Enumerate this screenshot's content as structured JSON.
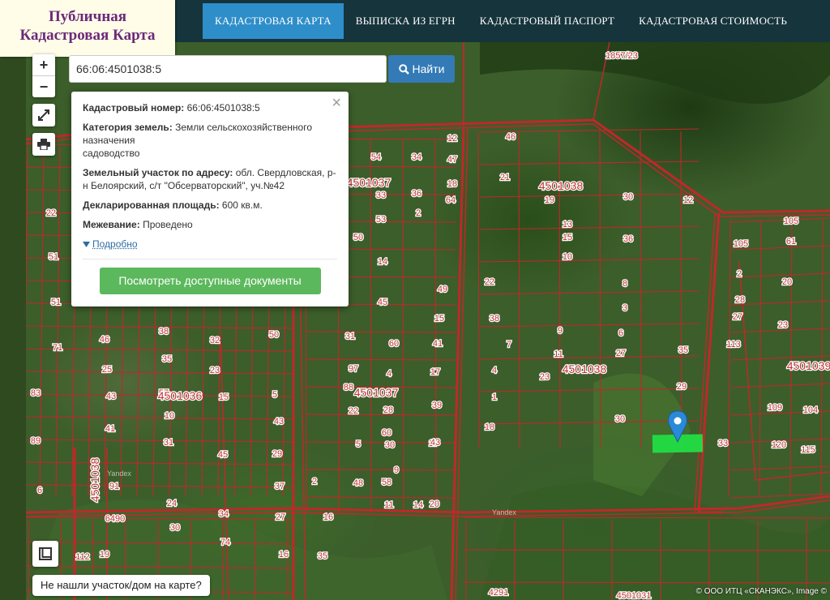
{
  "logo": {
    "line1": "Публичная",
    "line2": "Кадастровая Карта"
  },
  "nav": {
    "items": [
      {
        "label": "КАДАСТРОВАЯ КАРТА",
        "active": true
      },
      {
        "label": "ВЫПИСКА ИЗ ЕГРН",
        "active": false
      },
      {
        "label": "КАДАСТРОВЫЙ ПАСПОРТ",
        "active": false
      },
      {
        "label": "КАДАСТРОВАЯ СТОИМОСТЬ",
        "active": false
      }
    ]
  },
  "search": {
    "value": "66:06:4501038:5",
    "button_label": "Найти"
  },
  "controls": {
    "zoom_in": "+",
    "zoom_out": "−"
  },
  "popup": {
    "close": "×",
    "cadastral_number_label": "Кадастровый номер:",
    "cadastral_number": "66:06:4501038:5",
    "category_label": "Категория земель:",
    "category_value": "Земли сельскохозяйственного назначения",
    "usage": "садоводство",
    "address_label": "Земельный участок по адресу:",
    "address_value": "обл. Свердловская, р-н Белоярский, с/т \"Обсерваторский\", уч.№42",
    "area_label": "Декларированная площадь:",
    "area_value": "600 кв.м.",
    "survey_label": "Межевание:",
    "survey_value": "Проведено",
    "more_link": "Подробно",
    "docs_button": "Посмотреть доступные документы"
  },
  "map": {
    "quarter_labels": [
      "4501037",
      "4501038",
      "4501036",
      "4501037",
      "4501038",
      "4501039",
      "4501038"
    ],
    "plot_labels": [
      "1857/23",
      "54",
      "34",
      "12",
      "47",
      "46",
      "22",
      "33",
      "36",
      "18",
      "64",
      "2",
      "51",
      "53",
      "50",
      "21",
      "19",
      "30",
      "12",
      "13",
      "15",
      "36",
      "105",
      "105",
      "61",
      "51",
      "14",
      "10",
      "22",
      "49",
      "8",
      "2",
      "20",
      "45",
      "38",
      "15",
      "3",
      "71",
      "46",
      "38",
      "32",
      "50",
      "31",
      "60",
      "41",
      "9",
      "7",
      "6",
      "27",
      "35",
      "113",
      "28",
      "27",
      "23",
      "25",
      "35",
      "23",
      "97",
      "4",
      "17",
      "4",
      "11",
      "23",
      "83",
      "43",
      "57",
      "5",
      "88",
      "39",
      "1",
      "29",
      "41",
      "10",
      "15",
      "43",
      "22",
      "28",
      "17",
      "18",
      "30",
      "109",
      "104",
      "89",
      "31",
      "45",
      "29",
      "60",
      "5",
      "30",
      "43",
      "33",
      "120",
      "115",
      "6",
      "91",
      "2",
      "37",
      "48",
      "58",
      "9",
      "14",
      "20",
      "24",
      "34",
      "27",
      "16",
      "11",
      "6490",
      "30",
      "74",
      "16",
      "35",
      "112",
      "19",
      "4291",
      "4501031"
    ],
    "watermarks": [
      "Yandex",
      "Yandex"
    ]
  },
  "bottom": {
    "not_found": "Не нашли участок/дом на карте?",
    "attribution": "© ООО ИТЦ «СКАНЭКС», Image ©"
  },
  "colors": {
    "header_bg": "#16343c",
    "nav_active": "#2e8ec9",
    "logo_text": "#6b2a7a",
    "logo_bg": "#fffde8",
    "find_button": "#337ab7",
    "docs_button": "#5cb85c",
    "boundary_red": "#c0282a",
    "selected_plot": "#22dd44",
    "marker_blue": "#2a8ad8"
  }
}
